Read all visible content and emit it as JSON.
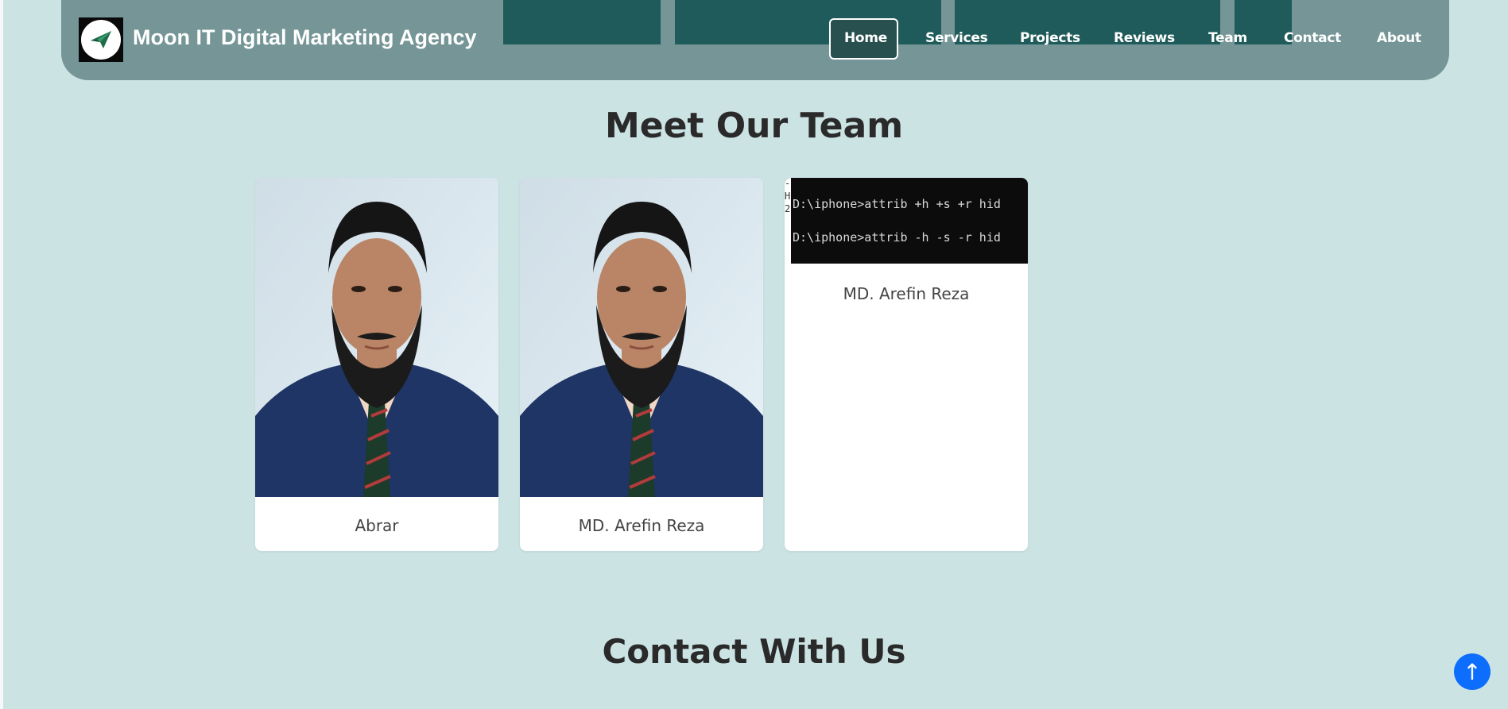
{
  "brand": {
    "name": "Moon IT Digital Marketing Agency",
    "logo_icon": "paper-plane-logo-icon",
    "logo_text": "Moon IT Digital"
  },
  "nav": {
    "items": [
      {
        "label": "Home",
        "active": true
      },
      {
        "label": "Services"
      },
      {
        "label": "Projects"
      },
      {
        "label": "Reviews"
      },
      {
        "label": "Team"
      },
      {
        "label": "Contact"
      },
      {
        "label": "About"
      }
    ]
  },
  "team": {
    "title": "Meet Our Team",
    "members": [
      {
        "name": "Abrar"
      },
      {
        "name": "MD. Arefin Reza"
      },
      {
        "name": "MD. Arefin Reza",
        "image_text": {
          "line1": "D:\\iphone>attrib +h +s +r hid",
          "line2": "D:\\iphone>attrib -h -s -r hid",
          "fragments": [
            "-",
            "H",
            "2"
          ]
        }
      }
    ]
  },
  "contact": {
    "title": "Contact With Us"
  },
  "back_to_top": {
    "icon": "arrow-up-icon",
    "glyph": "↑"
  },
  "colors": {
    "background": "#cce3e4",
    "navbar": "#759596",
    "navbar_accent": "#1f5b5a",
    "back_to_top": "#0d6efd"
  }
}
